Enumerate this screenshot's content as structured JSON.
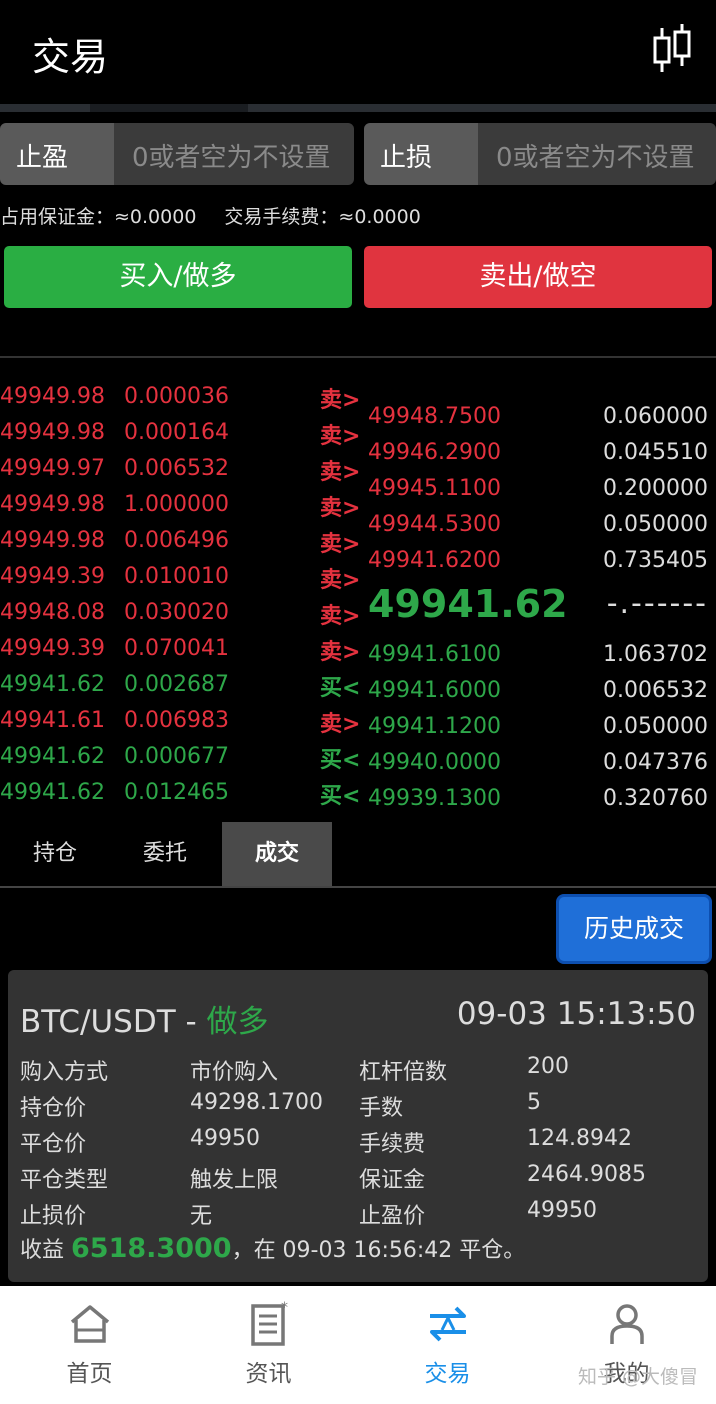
{
  "header": {
    "title": "交易",
    "chart_icon": "candlestick-icon"
  },
  "take_profit": {
    "label": "止盈",
    "placeholder": "0或者空为不设置"
  },
  "stop_loss": {
    "label": "止损",
    "placeholder": "0或者空为不设置"
  },
  "margin_info": {
    "margin": "占用保证金：≈0.0000",
    "fee": "交易手续费：≈0.0000"
  },
  "buttons": {
    "buy": "买入/做多",
    "sell": "卖出/做空"
  },
  "colors": {
    "buy": "#2aae43",
    "sell": "#e0343f",
    "accent": "#1f6fd8"
  },
  "trades": [
    {
      "price": "49949.98",
      "qty": "0.000036",
      "side": "卖>",
      "dir": "sell"
    },
    {
      "price": "49949.98",
      "qty": "0.000164",
      "side": "卖>",
      "dir": "sell"
    },
    {
      "price": "49949.97",
      "qty": "0.006532",
      "side": "卖>",
      "dir": "sell"
    },
    {
      "price": "49949.98",
      "qty": "1.000000",
      "side": "卖>",
      "dir": "sell"
    },
    {
      "price": "49949.98",
      "qty": "0.006496",
      "side": "卖>",
      "dir": "sell"
    },
    {
      "price": "49949.39",
      "qty": "0.010010",
      "side": "卖>",
      "dir": "sell"
    },
    {
      "price": "49948.08",
      "qty": "0.030020",
      "side": "卖>",
      "dir": "sell"
    },
    {
      "price": "49949.39",
      "qty": "0.070041",
      "side": "卖>",
      "dir": "sell"
    },
    {
      "price": "49941.62",
      "qty": "0.002687",
      "side": "买<",
      "dir": "buy"
    },
    {
      "price": "49941.61",
      "qty": "0.006983",
      "side": "卖>",
      "dir": "sell"
    },
    {
      "price": "49941.62",
      "qty": "0.000677",
      "side": "买<",
      "dir": "buy"
    },
    {
      "price": "49941.62",
      "qty": "0.012465",
      "side": "买<",
      "dir": "buy"
    }
  ],
  "order_book": {
    "asks": [
      {
        "price": "49948.7500",
        "qty": "0.060000"
      },
      {
        "price": "49946.2900",
        "qty": "0.045510"
      },
      {
        "price": "49945.1100",
        "qty": "0.200000"
      },
      {
        "price": "49944.5300",
        "qty": "0.050000"
      },
      {
        "price": "49941.6200",
        "qty": "0.735405"
      }
    ],
    "last_price": "49941.62",
    "last_dash": "-.------",
    "bids": [
      {
        "price": "49941.6100",
        "qty": "1.063702"
      },
      {
        "price": "49941.6000",
        "qty": "0.006532"
      },
      {
        "price": "49941.1200",
        "qty": "0.050000"
      },
      {
        "price": "49940.0000",
        "qty": "0.047376"
      },
      {
        "price": "49939.1300",
        "qty": "0.320760"
      }
    ]
  },
  "position_tabs": [
    "持仓",
    "委托",
    "成交"
  ],
  "history_button": "历史成交",
  "card": {
    "pair": "BTC/USDT - ",
    "side": "做多",
    "time": "09-03 15:13:50",
    "rows": [
      [
        "购入方式",
        "市价购入",
        "杠杆倍数",
        "200"
      ],
      [
        "持仓价",
        "49298.1700",
        "手数",
        "5"
      ],
      [
        "平仓价",
        "49950",
        "手续费",
        "124.8942"
      ],
      [
        "平仓类型",
        "触发上限",
        "保证金",
        "2464.9085"
      ],
      [
        "止损价",
        "无",
        "止盈价",
        "49950"
      ]
    ],
    "profit_label": "收益 ",
    "profit_value": "6518.3000",
    "profit_suffix": "，在 09-03 16:56:42 平仓。"
  },
  "nav": [
    {
      "label": "首页",
      "icon": "home-icon"
    },
    {
      "label": "资讯",
      "icon": "news-icon"
    },
    {
      "label": "交易",
      "icon": "exchange-icon"
    },
    {
      "label": "我的",
      "icon": "user-icon"
    }
  ],
  "watermark": "知乎 @大傻冒"
}
